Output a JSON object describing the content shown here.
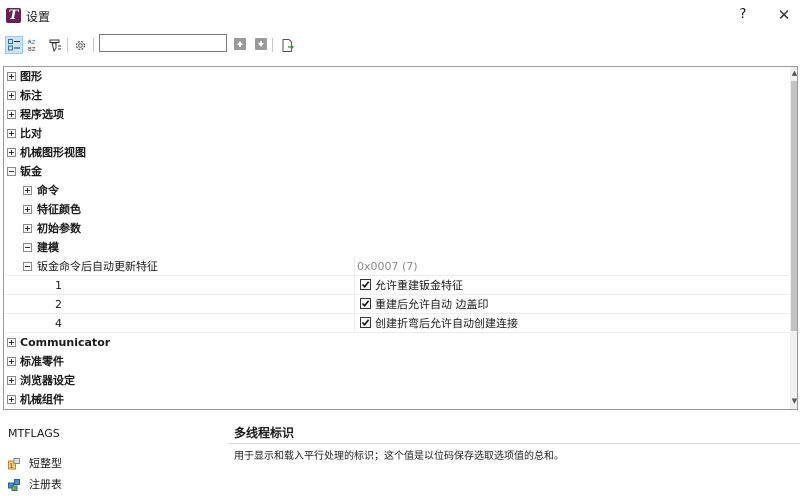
{
  "window": {
    "title": "设置",
    "help_label": "?",
    "close_label": "✕"
  },
  "search": {
    "value": ""
  },
  "tree": {
    "top_items": [
      "图形",
      "标注",
      "程序选项",
      "比对",
      "机械图形视图"
    ],
    "sheetmetal": "钣金",
    "sheetmetal_children": [
      "命令",
      "特征颜色",
      "初始参数"
    ],
    "modeling": "建模",
    "property": {
      "name": "钣金命令后自动更新特征",
      "value": "0x0007 (7)"
    },
    "options": [
      {
        "key": "1",
        "label": "允许重建钣金特征"
      },
      {
        "key": "2",
        "label": "重建后允许自动 边盖印"
      },
      {
        "key": "4",
        "label": "创建折弯后允许自动创建连接"
      }
    ],
    "bottom_items": [
      "Communicator",
      "标准零件",
      "浏览器设定",
      "机械组件"
    ]
  },
  "details": {
    "variable_name": "MTFLAGS",
    "title": "多线程标识",
    "description": "用于显示和载入平行处理的标识；这个值是以位码保存选取选项值的总和。",
    "type_label": "短整型",
    "storage_label": "注册表"
  }
}
